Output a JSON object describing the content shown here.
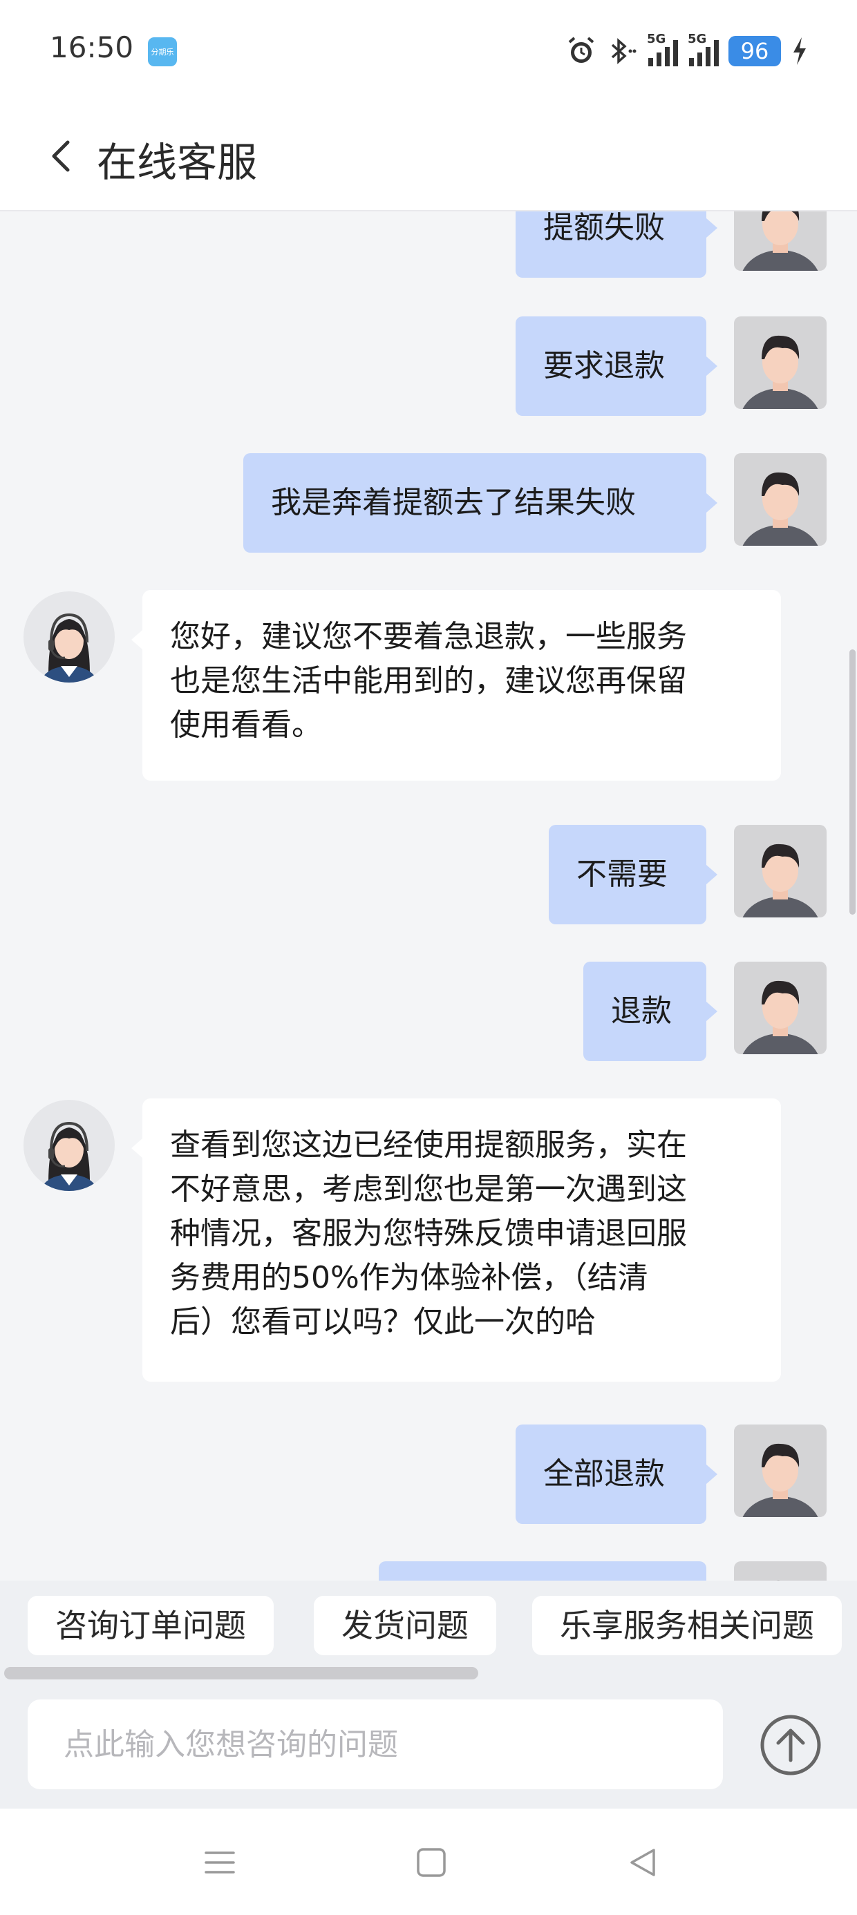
{
  "status_bar": {
    "time": "16:50",
    "app_badge": "分期乐",
    "network_1": "5G",
    "network_2": "5G",
    "battery": "96",
    "icons": [
      "alarm-icon",
      "bluetooth-icon",
      "signal-icon",
      "signal-icon",
      "battery-icon",
      "charging-icon"
    ]
  },
  "header": {
    "title": "在线客服",
    "back_icon": "chevron-left-icon"
  },
  "chat": {
    "messages": [
      {
        "from": "user",
        "text": "提额失败"
      },
      {
        "from": "user",
        "text": "要求退款"
      },
      {
        "from": "user",
        "text": "我是奔着提额去了结果失败"
      },
      {
        "from": "agent",
        "lines": [
          "您好，建议您不要着急退款，一些服务",
          "也是您生活中能用到的，建议您再保留",
          "使用看看。"
        ]
      },
      {
        "from": "user",
        "text": "不需要"
      },
      {
        "from": "user",
        "text": "退款"
      },
      {
        "from": "agent",
        "lines": [
          "查看到您这边已经使用提额服务，实在",
          "不好意思，考虑到您也是第一次遇到这",
          "种情况，客服为您特殊反馈申请退回服",
          "务费用的50%作为体验补偿，（结清",
          "后）您看可以吗？仅此一次的哈"
        ]
      },
      {
        "from": "user",
        "text": "全部退款"
      }
    ],
    "user_bubble_color": "#c6d7fb",
    "agent_bubble_color": "#ffffff"
  },
  "quick_replies": [
    "咨询订单问题",
    "发货问题",
    "乐享服务相关问题"
  ],
  "input": {
    "placeholder": "点此输入您想咨询的问题",
    "send_icon": "arrow-up-circle-icon"
  },
  "nav_bar": {
    "icons": [
      "menu-icon",
      "home-square-icon",
      "back-triangle-icon"
    ]
  }
}
